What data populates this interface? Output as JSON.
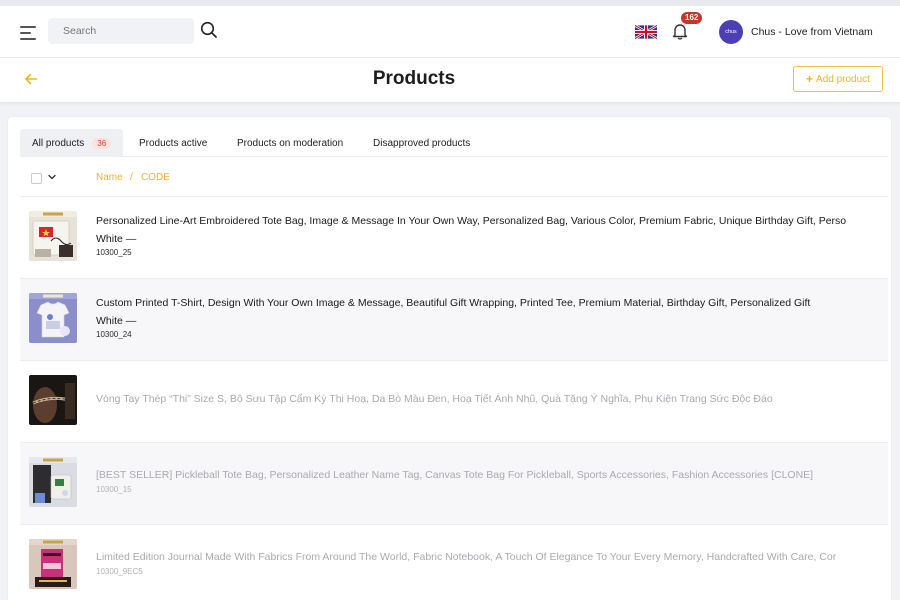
{
  "header": {
    "search_placeholder": "Search",
    "notification_count": "162",
    "avatar_text": "chus",
    "shop_name": "Chus - Love from Vietnam"
  },
  "page": {
    "title": "Products",
    "add_button_label": "Add product"
  },
  "tabs": [
    {
      "label": "All products",
      "count": "36"
    },
    {
      "label": "Products active"
    },
    {
      "label": "Products on moderation"
    },
    {
      "label": "Disapproved products"
    }
  ],
  "columns": {
    "name": "Name",
    "separator": "/",
    "code": "CODE"
  },
  "products": [
    {
      "name": "Personalized Line-Art Embroidered Tote Bag, Image & Message In Your Own Way, Personalized Bag, Various Color, Premium Fabric, Unique Birthday Gift, Perso",
      "variant": "White —",
      "code": "10300_25",
      "status": "active"
    },
    {
      "name": "Custom Printed T-Shirt, Design With Your Own Image & Message, Beautiful Gift Wrapping, Printed Tee, Premium Material, Birthday Gift, Personalized Gift",
      "variant": "White —",
      "code": "10300_24",
      "status": "active"
    },
    {
      "name": "Vòng Tay Thép “Thi” Size S, Bộ Sưu Tập Cẩm Kỳ Thi Hoạ, Da Bò Màu Đen, Hoạ Tiết Ánh Nhũ, Quà Tặng Ý Nghĩa, Phụ Kiện Trang Sức Độc Đáo",
      "status": "inactive"
    },
    {
      "name": "[BEST SELLER] Pickleball Tote Bag, Personalized Leather Name Tag, Canvas Tote Bag For Pickleball, Sports Accessories, Fashion Accessories [CLONE]",
      "code": "10300_15",
      "status": "inactive"
    },
    {
      "name": "Limited Edition Journal Made With Fabrics From Around The World, Fabric Notebook, A Touch Of Elegance To Your Every Memory, Handcrafted With Care, Cor",
      "code": "10300_9EC5",
      "status": "inactive"
    }
  ],
  "icons": {
    "menu": "hamburger-menu-icon",
    "search": "search-icon",
    "language": "uk-flag-icon",
    "notifications": "bell-icon",
    "back": "arrow-left-icon",
    "add": "plus-icon"
  },
  "colors": {
    "accent": "#f0b427",
    "badge_red": "#c0392b",
    "avatar_bg": "#4b3fb4",
    "count_badge_text": "#d1442c",
    "muted_text": "#a9aab0"
  }
}
